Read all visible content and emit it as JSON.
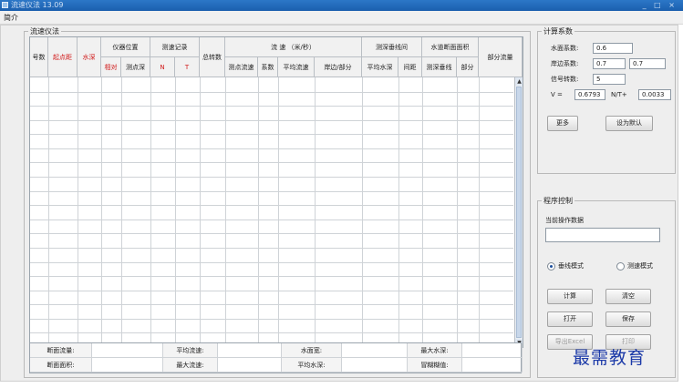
{
  "window": {
    "title": "流速仪法 13.09",
    "controls": "_ □ ×"
  },
  "menu": {
    "label": "简介"
  },
  "flow_panel": {
    "legend": "流速仪法",
    "headers": {
      "seq": "号数",
      "start_dist": "起点距",
      "depth": "水深",
      "instr_pos": "仪器位置",
      "relative": "相对",
      "point_depth": "测点深",
      "record": "测速记录",
      "record_n": "N",
      "record_t": "T",
      "revolutions": "总转数",
      "velocity": "流 速 （米/秒）",
      "point_vel": "测点流速",
      "coef": "系数",
      "avg_vel": "平均流速",
      "bank_part": "岸边/部分",
      "sounding": "测深垂线间",
      "avg_depth": "平均水深",
      "spacing": "间距",
      "area": "水道断面面积",
      "area_sound": "测深垂线",
      "area_part": "部分",
      "part_flow": "部分流量"
    },
    "row_count": 19
  },
  "summary": {
    "rows": [
      [
        "断面流量:",
        "",
        "平均流速:",
        "",
        "水面宽:",
        "",
        "最大水深:",
        ""
      ],
      [
        "断面面积:",
        "",
        "最大流速:",
        "",
        "平均水深:",
        "",
        "冒糊糊值:",
        ""
      ]
    ]
  },
  "calc_panel": {
    "legend": "计算系数",
    "water_coef_label": "水面系数:",
    "water_coef_value": "0.6",
    "bank_coef_label": "岸边系数:",
    "bank_coef_left": "0.7",
    "bank_coef_right": "0.7",
    "signal_label": "信号转数:",
    "signal_value": "5",
    "v_label": "V =",
    "v_value": "0.6793",
    "nt_label": "N/T+",
    "nt_value": "0.0033",
    "more_label": "更多",
    "default_label": "设为默认"
  },
  "program_panel": {
    "legend": "程序控制",
    "current_label": "当前操作数据",
    "current_value": "",
    "mode_vertical": "垂线模式",
    "mode_speed": "测速模式",
    "selected_mode": "垂线模式",
    "btn_calc": "计算",
    "btn_clear": "清空",
    "btn_open": "打开",
    "btn_save": "保存",
    "btn_export": "导出Excel",
    "btn_print": "打印"
  },
  "watermark": "最需教育"
}
